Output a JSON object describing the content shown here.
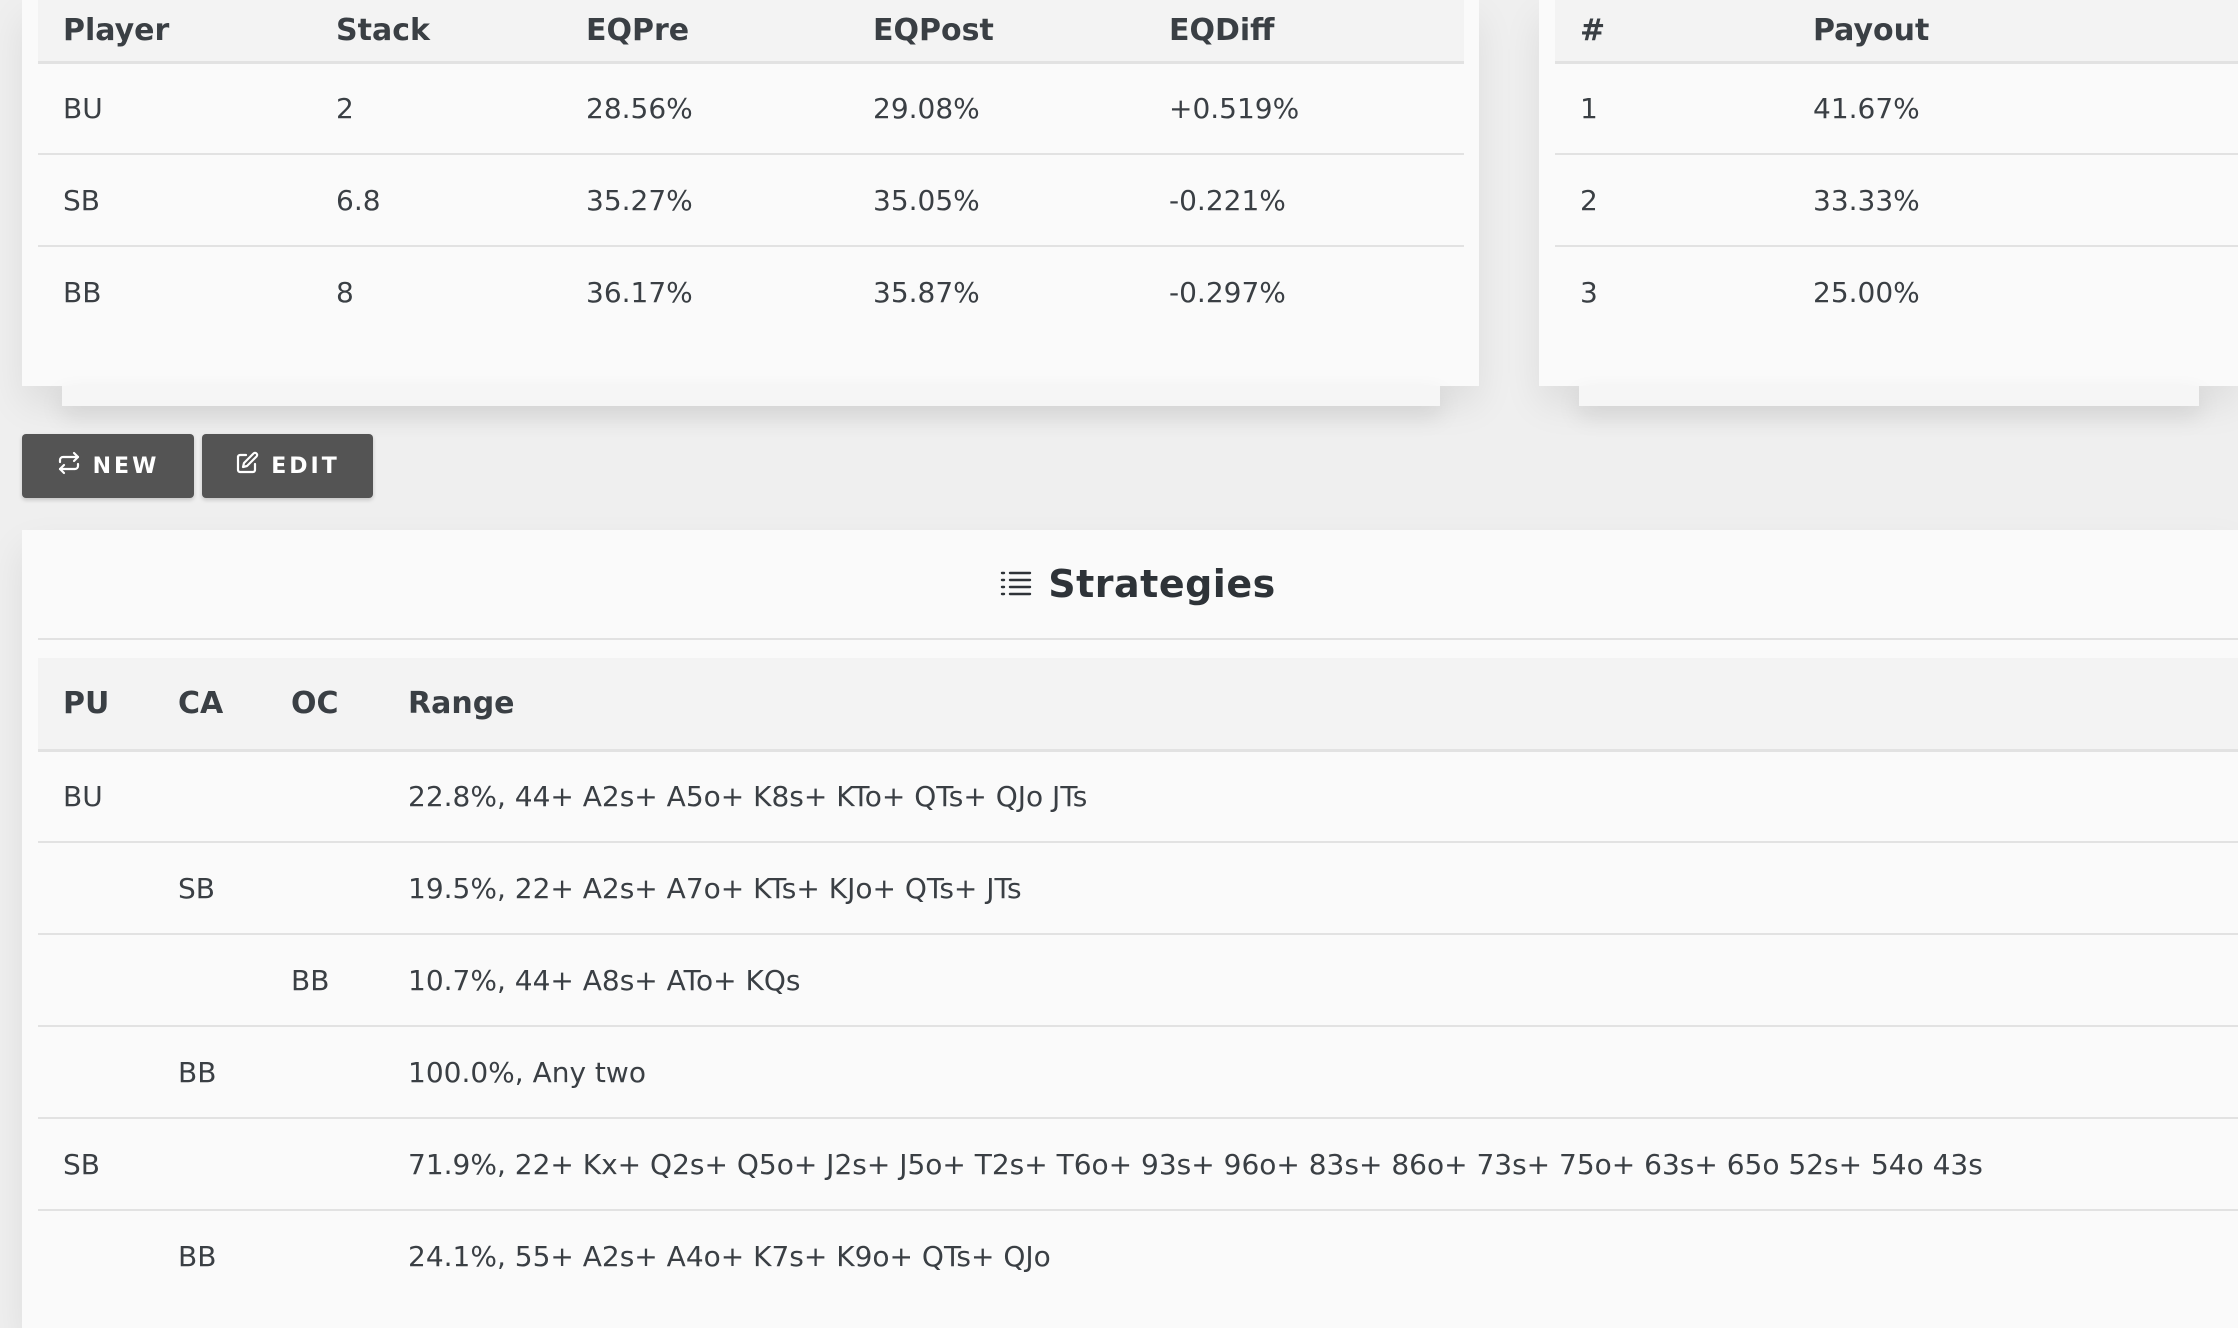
{
  "equity_table": {
    "headers": [
      "Player",
      "Stack",
      "EQPre",
      "EQPost",
      "EQDiff"
    ],
    "rows": [
      [
        "BU",
        "2",
        "28.56%",
        "29.08%",
        "+0.519%"
      ],
      [
        "SB",
        "6.8",
        "35.27%",
        "35.05%",
        "-0.221%"
      ],
      [
        "BB",
        "8",
        "36.17%",
        "35.87%",
        "-0.297%"
      ]
    ]
  },
  "payout_table": {
    "headers": [
      "#",
      "Payout"
    ],
    "rows": [
      [
        "1",
        "41.67%"
      ],
      [
        "2",
        "33.33%"
      ],
      [
        "3",
        "25.00%"
      ]
    ]
  },
  "buttons": {
    "new_label": "NEW",
    "new_icon": "repeat-icon",
    "edit_label": "EDIT",
    "edit_icon": "edit-icon"
  },
  "strategies": {
    "title": "Strategies",
    "title_icon": "list-icon",
    "headers": [
      "PU",
      "CA",
      "OC",
      "Range"
    ],
    "rows": [
      [
        "BU",
        "",
        "",
        "22.8%, 44+ A2s+ A5o+ K8s+ KTo+ QTs+ QJo JTs"
      ],
      [
        "",
        "SB",
        "",
        "19.5%, 22+ A2s+ A7o+ KTs+ KJo+ QTs+ JTs"
      ],
      [
        "",
        "",
        "BB",
        "10.7%, 44+ A8s+ ATo+ KQs"
      ],
      [
        "",
        "BB",
        "",
        "100.0%, Any two"
      ],
      [
        "SB",
        "",
        "",
        "71.9%, 22+ Kx+ Q2s+ Q5o+ J2s+ J5o+ T2s+ T6o+ 93s+ 96o+ 83s+ 86o+ 73s+ 75o+ 63s+ 65o 52s+ 54o 43s"
      ],
      [
        "",
        "BB",
        "",
        "24.1%, 55+ A2s+ A4o+ K7s+ K9o+ QTs+ QJo"
      ]
    ]
  },
  "colors": {
    "background": "#efefef",
    "card": "#fafafa",
    "header_row": "#f3f3f3",
    "button": "#545454"
  }
}
